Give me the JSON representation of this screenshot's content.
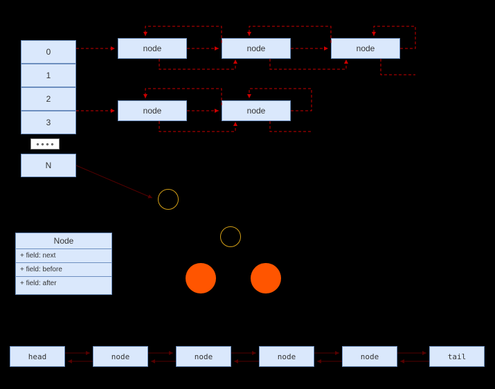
{
  "register": {
    "cells": [
      "0",
      "1",
      "2",
      "3"
    ],
    "dots_label": "",
    "last_cell": "N"
  },
  "nodes": {
    "row1": [
      "node",
      "node",
      "node"
    ],
    "row2": [
      "node",
      "node"
    ]
  },
  "uml": {
    "title": "Node",
    "fields": [
      "+ field: next",
      "+ field: before",
      "+ field: after"
    ]
  },
  "bottom_list": [
    "head",
    "node",
    "node",
    "node",
    "node",
    "tail"
  ],
  "chart_data": {
    "type": "diagram",
    "description": "Hash table / register array with chained linked-list nodes (doubly-linked) and UML-style Node fields, tree of circles, and doubly-linked list at bottom",
    "register_indices": [
      "0",
      "1",
      "2",
      "3",
      "...",
      "N"
    ],
    "chains": {
      "0": [
        "node",
        "node",
        "node"
      ],
      "2": [
        "node",
        "node"
      ]
    },
    "uml_node_fields": [
      "next",
      "before",
      "after"
    ],
    "circle_nodes": {
      "empty": 2,
      "filled": 2
    },
    "linked_list": [
      "head",
      "node",
      "node",
      "node",
      "node",
      "tail"
    ]
  }
}
